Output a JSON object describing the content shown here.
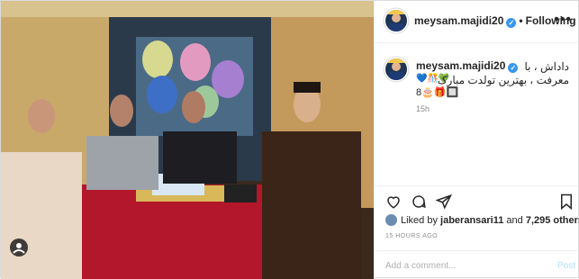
{
  "post": {
    "username": "meysam.majidi20",
    "follow_state": "Following",
    "separator": "•",
    "verified_glyph": "✓",
    "more_glyph": "•••",
    "caption": {
      "line1": "داداش ، با",
      "line2": "معرفت ، بهترین تولدت مبارک",
      "emoji_strip": "💙🎊💚",
      "line3": "8🎂🎁🔲",
      "time": "15h"
    },
    "likes": {
      "prefix": "Liked by ",
      "user": "jaberansari11",
      "connector": " and ",
      "count": "7,295 others"
    },
    "time_ago": "15 HOURS AGO",
    "comment_placeholder": "Add a comment...",
    "post_label": "Post"
  },
  "icons": [
    "more-icon",
    "verified-icon",
    "heart-icon",
    "comment-icon",
    "share-icon",
    "bookmark-icon",
    "reels-user-icon"
  ],
  "colors": {
    "accent": "#3897f0",
    "post_disabled": "#b2dffc",
    "border": "#dbdbdb"
  }
}
